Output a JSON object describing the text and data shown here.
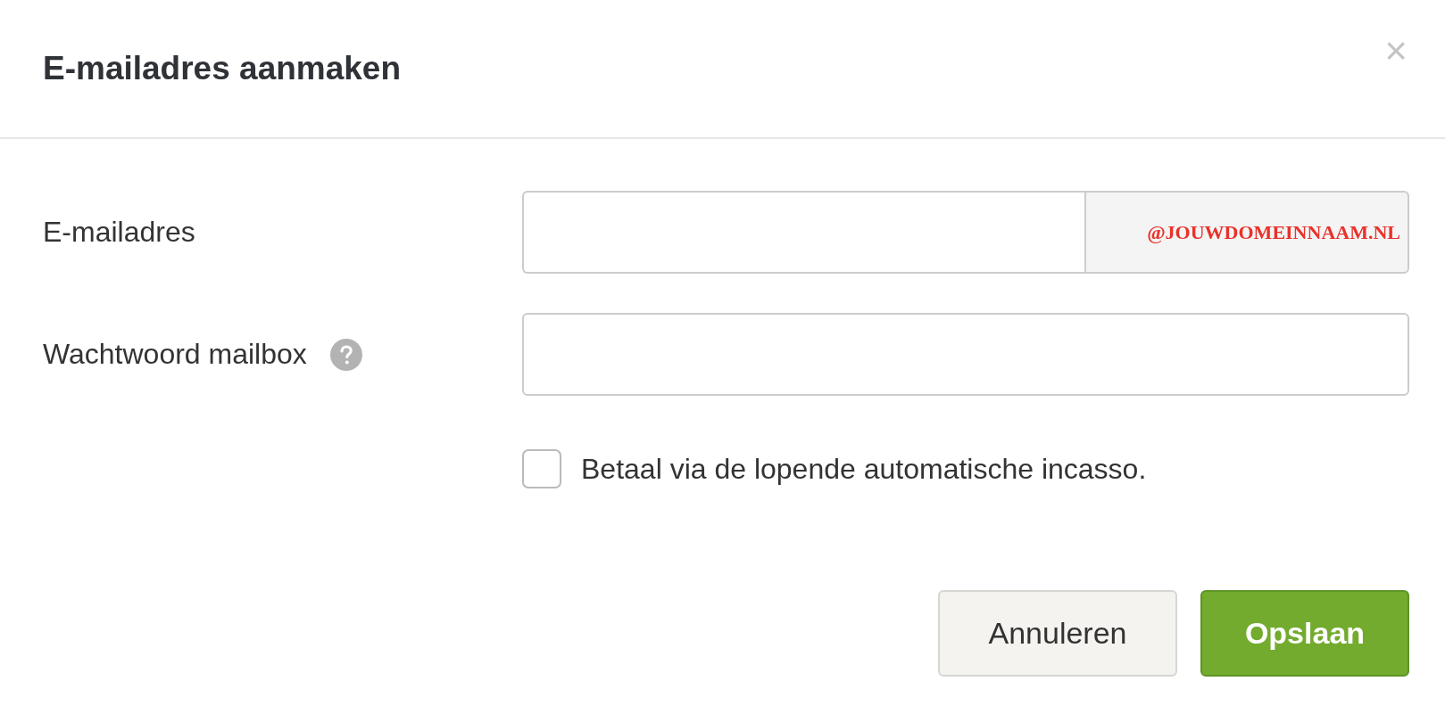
{
  "dialog": {
    "title": "E-mailadres aanmaken",
    "close": "×"
  },
  "fields": [
    {
      "label": "E-mailadres",
      "kind": "email",
      "suffix": "@JOUWDOMEINNAAM.NL",
      "help": false
    },
    {
      "label": "Wachtwoord mailbox",
      "kind": "password",
      "help": true
    }
  ],
  "checkbox": {
    "label": "Betaal via de lopende automatische incasso.",
    "checked": false
  },
  "buttons": [
    {
      "label": "Annuleren",
      "kind": "secondary"
    },
    {
      "label": "Opslaan",
      "kind": "primary"
    }
  ]
}
